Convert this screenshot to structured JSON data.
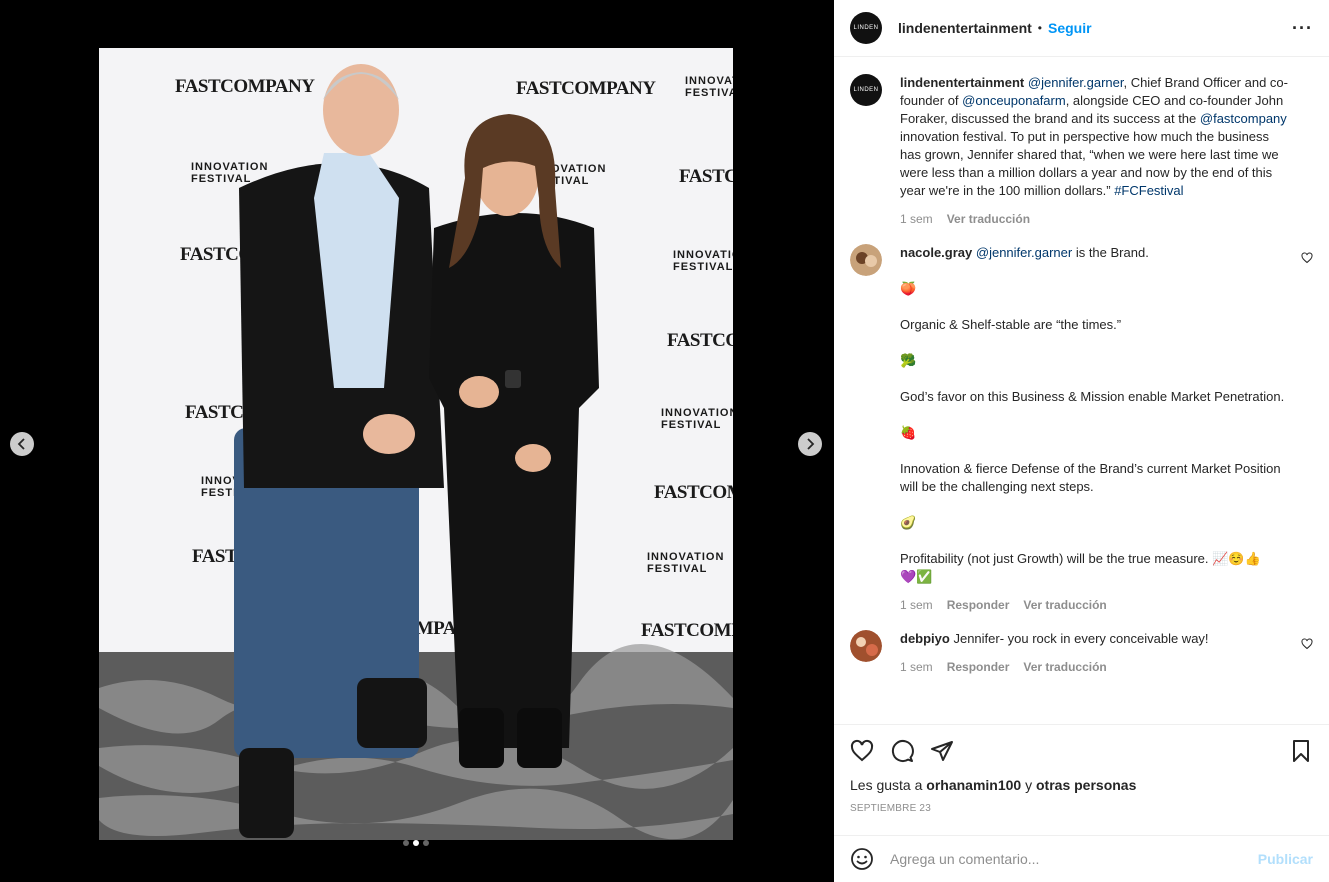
{
  "post": {
    "account": "lindenentertainment",
    "avatar_text": "LINDEN",
    "separator": "•",
    "follow_label": "Seguir",
    "more_label": "···",
    "caption": {
      "username": "lindenentertainment",
      "m1": "@jennifer.garner",
      "t1": ", Chief Brand Officer and co-founder of ",
      "m2": "@onceuponafarm",
      "t2": ", alongside CEO and co-founder John Foraker, discussed the brand and its success at the ",
      "m3": "@fastcompany",
      "t3": " innovation festival. To put in perspective how much the business has grown, Jennifer shared that, “when we were here last time we were less than a million dollars a year and now by the end of this year we're in the 100 million dollars.” ",
      "hashtag": "#FCFestival",
      "time": "1 sem",
      "translate": "Ver traducción"
    },
    "comments": [
      {
        "username": "nacole.gray",
        "mention": "@jennifer.garner",
        "text": " is the Brand.",
        "e1": "🍑",
        "p1": "Organic & Shelf-stable are “the times.”",
        "e2": "🥦",
        "p2": "God’s favor on this Business & Mission enable Market Penetration.",
        "e3": "🍓",
        "p3": "Innovation & fierce Defense of the Brand’s current Market Position will be the challenging next steps.",
        "e4": "🥑",
        "p4": "Profitability (not just Growth) will be the true measure. 📈☺️👍",
        "p4b": "💜✅",
        "time": "1 sem",
        "reply": "Responder",
        "translate": "Ver traducción"
      },
      {
        "username": "debpiyo",
        "text": "Jennifer- you rock in every conceivable way!",
        "time": "1 sem",
        "reply": "Responder",
        "translate": "Ver traducción"
      }
    ],
    "likes": {
      "prefix": "Les gusta a ",
      "user": "orhanamin100",
      "mid": " y ",
      "others": "otras personas"
    },
    "date": "SEPTIEMBRE 23",
    "add_comment_placeholder": "Agrega un comentario...",
    "post_label": "Publicar",
    "carousel": {
      "count": 3,
      "active_index": 1
    },
    "backdrop": {
      "brand": "FASTCOMPANY",
      "inno_line1": "INNOVATION",
      "inno_line2": "FESTIVAL"
    },
    "icons": [
      "heart-icon",
      "comment-icon",
      "share-icon",
      "bookmark-icon",
      "smile-icon",
      "chevron-left-icon",
      "chevron-right-icon"
    ],
    "colors": {
      "link": "#0095f6",
      "mention": "#00376b",
      "muted": "#8e8e8e",
      "post_disabled": "#b2dffc"
    }
  }
}
